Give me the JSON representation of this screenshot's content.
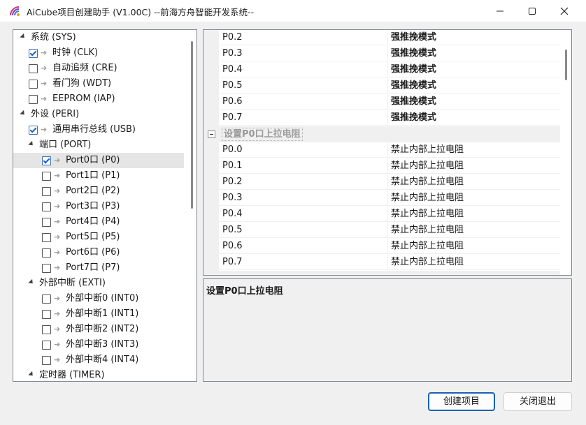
{
  "window": {
    "title": "AiCube项目创建助手 (V1.00C) --前海方舟智能开发系统--"
  },
  "tree": {
    "rows": [
      {
        "label": "系统 (SYS)",
        "expander": true,
        "checkbox": false,
        "checked": false,
        "arrow": false,
        "level": 0
      },
      {
        "label": "时钟 (CLK)",
        "expander": false,
        "checkbox": true,
        "checked": true,
        "arrow": true,
        "level": 1
      },
      {
        "label": "自动追频 (CRE)",
        "expander": false,
        "checkbox": true,
        "checked": false,
        "arrow": true,
        "level": 1
      },
      {
        "label": "看门狗 (WDT)",
        "expander": false,
        "checkbox": true,
        "checked": false,
        "arrow": true,
        "level": 1
      },
      {
        "label": "EEPROM (IAP)",
        "expander": false,
        "checkbox": true,
        "checked": false,
        "arrow": true,
        "level": 1
      },
      {
        "label": "外设 (PERI)",
        "expander": true,
        "checkbox": false,
        "checked": false,
        "arrow": false,
        "level": 0
      },
      {
        "label": "通用串行总线 (USB)",
        "expander": false,
        "checkbox": true,
        "checked": true,
        "arrow": true,
        "level": 1
      },
      {
        "label": "端口 (PORT)",
        "expander": true,
        "checkbox": false,
        "checked": false,
        "arrow": false,
        "level": 1
      },
      {
        "label": "Port0口 (P0)",
        "expander": false,
        "checkbox": true,
        "checked": true,
        "arrow": true,
        "level": 2,
        "selected": true
      },
      {
        "label": "Port1口 (P1)",
        "expander": false,
        "checkbox": true,
        "checked": false,
        "arrow": true,
        "level": 2
      },
      {
        "label": "Port2口 (P2)",
        "expander": false,
        "checkbox": true,
        "checked": false,
        "arrow": true,
        "level": 2
      },
      {
        "label": "Port3口 (P3)",
        "expander": false,
        "checkbox": true,
        "checked": false,
        "arrow": true,
        "level": 2
      },
      {
        "label": "Port4口 (P4)",
        "expander": false,
        "checkbox": true,
        "checked": false,
        "arrow": true,
        "level": 2
      },
      {
        "label": "Port5口 (P5)",
        "expander": false,
        "checkbox": true,
        "checked": false,
        "arrow": true,
        "level": 2
      },
      {
        "label": "Port6口 (P6)",
        "expander": false,
        "checkbox": true,
        "checked": false,
        "arrow": true,
        "level": 2
      },
      {
        "label": "Port7口 (P7)",
        "expander": false,
        "checkbox": true,
        "checked": false,
        "arrow": true,
        "level": 2
      },
      {
        "label": "外部中断 (EXTI)",
        "expander": true,
        "checkbox": false,
        "checked": false,
        "arrow": false,
        "level": 1
      },
      {
        "label": "外部中断0 (INT0)",
        "expander": false,
        "checkbox": true,
        "checked": false,
        "arrow": true,
        "level": 2
      },
      {
        "label": "外部中断1 (INT1)",
        "expander": false,
        "checkbox": true,
        "checked": false,
        "arrow": true,
        "level": 2
      },
      {
        "label": "外部中断2 (INT2)",
        "expander": false,
        "checkbox": true,
        "checked": false,
        "arrow": true,
        "level": 2
      },
      {
        "label": "外部中断3 (INT3)",
        "expander": false,
        "checkbox": true,
        "checked": false,
        "arrow": true,
        "level": 2
      },
      {
        "label": "外部中断4 (INT4)",
        "expander": false,
        "checkbox": true,
        "checked": false,
        "arrow": true,
        "level": 2
      },
      {
        "label": "定时器 (TIMER)",
        "expander": true,
        "checkbox": false,
        "checked": false,
        "arrow": false,
        "level": 1
      }
    ]
  },
  "property_grid": {
    "rows": [
      {
        "type": "prop",
        "name": "P0.2",
        "value": "强推挽模式",
        "bold": true
      },
      {
        "type": "prop",
        "name": "P0.3",
        "value": "强推挽模式",
        "bold": true
      },
      {
        "type": "prop",
        "name": "P0.4",
        "value": "强推挽模式",
        "bold": true
      },
      {
        "type": "prop",
        "name": "P0.5",
        "value": "强推挽模式",
        "bold": true
      },
      {
        "type": "prop",
        "name": "P0.6",
        "value": "强推挽模式",
        "bold": true
      },
      {
        "type": "prop",
        "name": "P0.7",
        "value": "强推挽模式",
        "bold": true
      },
      {
        "type": "category",
        "name": "设置P0口上拉电阻"
      },
      {
        "type": "prop",
        "name": "P0.0",
        "value": "禁止内部上拉电阻",
        "bold": false
      },
      {
        "type": "prop",
        "name": "P0.1",
        "value": "禁止内部上拉电阻",
        "bold": false
      },
      {
        "type": "prop",
        "name": "P0.2",
        "value": "禁止内部上拉电阻",
        "bold": false
      },
      {
        "type": "prop",
        "name": "P0.3",
        "value": "禁止内部上拉电阻",
        "bold": false
      },
      {
        "type": "prop",
        "name": "P0.4",
        "value": "禁止内部上拉电阻",
        "bold": false
      },
      {
        "type": "prop",
        "name": "P0.5",
        "value": "禁止内部上拉电阻",
        "bold": false
      },
      {
        "type": "prop",
        "name": "P0.6",
        "value": "禁止内部上拉电阻",
        "bold": false
      },
      {
        "type": "prop",
        "name": "P0.7",
        "value": "禁止内部上拉电阻",
        "bold": false
      }
    ]
  },
  "description": {
    "title": "设置P0口上拉电阻"
  },
  "buttons": {
    "create_label": "创建项目",
    "close_label": "关闭退出"
  },
  "colors": {
    "accent": "#1a5fb4",
    "selection": "#e5e5e5"
  }
}
